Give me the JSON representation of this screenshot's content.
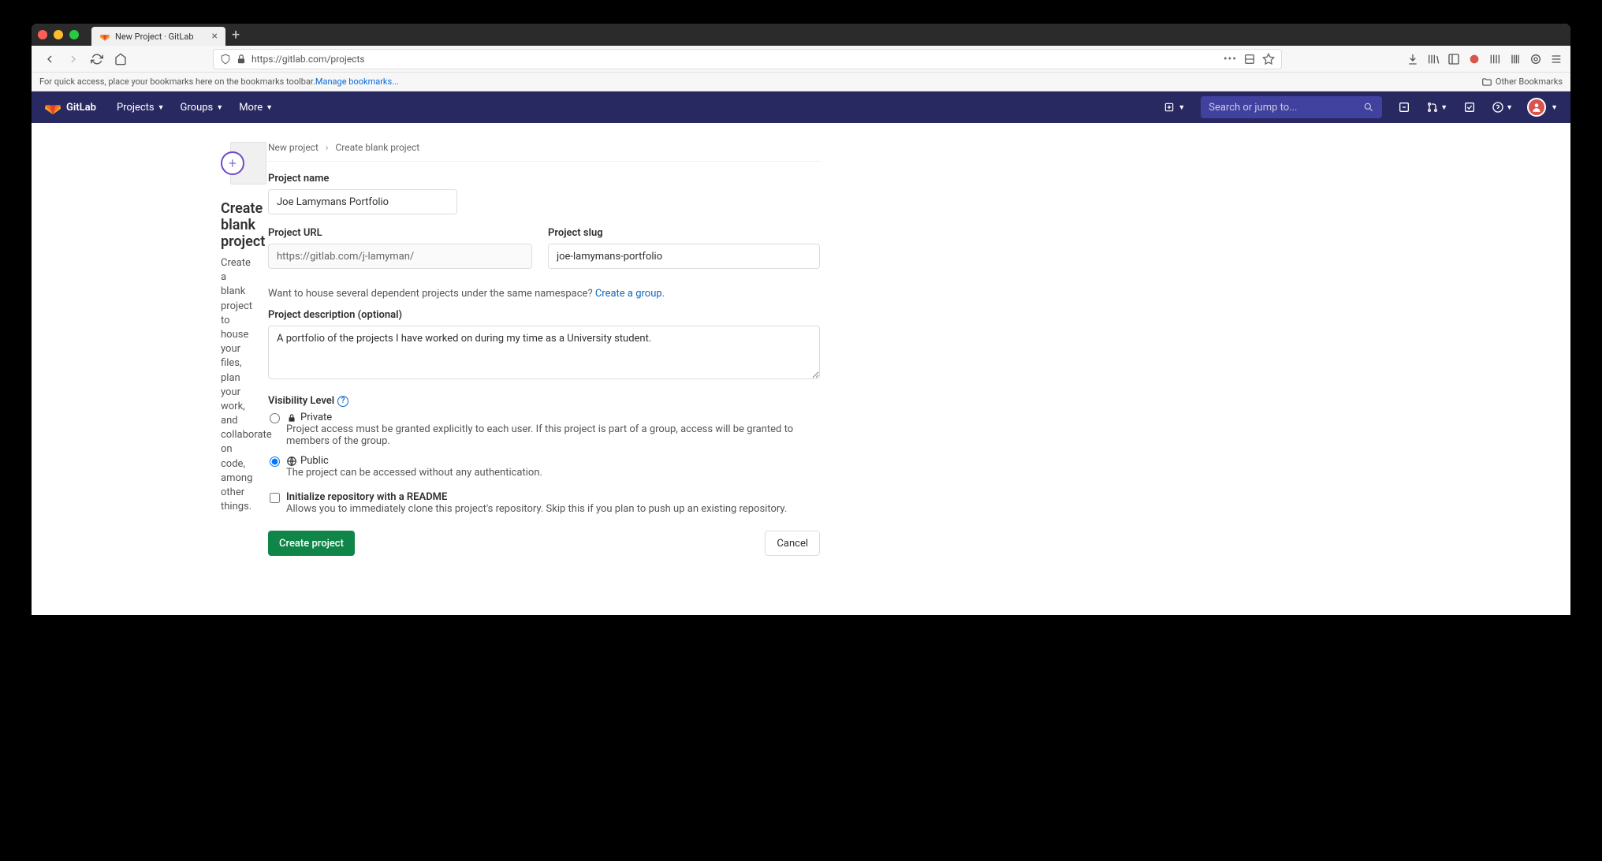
{
  "browser": {
    "tab_title": "New Project · GitLab",
    "url": "https://gitlab.com/projects",
    "bookmark_hint": "For quick access, place your bookmarks here on the bookmarks toolbar. ",
    "manage_bookmarks": "Manage bookmarks...",
    "other_bookmarks": "Other Bookmarks"
  },
  "nav": {
    "brand": "GitLab",
    "projects": "Projects",
    "groups": "Groups",
    "more": "More",
    "search_placeholder": "Search or jump to..."
  },
  "sidebar": {
    "title": "Create blank project",
    "desc": "Create a blank project to house your files, plan your work, and collaborate on code, among other things."
  },
  "breadcrumb": {
    "a": "New project",
    "b": "Create blank project"
  },
  "form": {
    "name_label": "Project name",
    "name_value": "Joe Lamymans Portfolio",
    "url_label": "Project URL",
    "url_value": "https://gitlab.com/j-lamyman/",
    "slug_label": "Project slug",
    "slug_value": "joe-lamymans-portfolio",
    "namespace_hint": "Want to house several dependent projects under the same namespace? ",
    "create_group": "Create a group.",
    "desc_label": "Project description (optional)",
    "desc_value": "A portfolio of the projects I have worked on during my time as a University student.",
    "vis_label": "Visibility Level",
    "private_title": "Private",
    "private_desc": "Project access must be granted explicitly to each user. If this project is part of a group, access will be granted to members of the group.",
    "public_title": "Public",
    "public_desc": "The project can be accessed without any authentication.",
    "readme_title": "Initialize repository with a README",
    "readme_desc": "Allows you to immediately clone this project's repository. Skip this if you plan to push up an existing repository.",
    "create_btn": "Create project",
    "cancel_btn": "Cancel"
  }
}
